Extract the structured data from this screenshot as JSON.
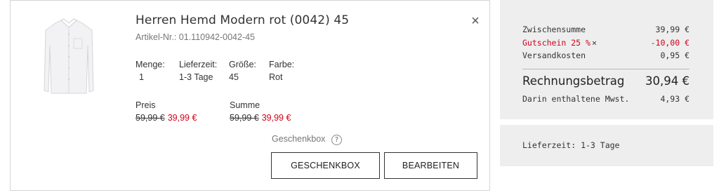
{
  "product": {
    "title": "Herren Hemd Modern rot (0042) 45",
    "article_number": "Artikel-Nr.: 01.110942-0042-45",
    "image_icon": "shirt-image",
    "close_icon": "×",
    "attributes": [
      {
        "label": "Menge:",
        "value": "1"
      },
      {
        "label": "Lieferzeit:",
        "value": "1-3 Tage"
      },
      {
        "label": "Größe:",
        "value": "45"
      },
      {
        "label": "Farbe:",
        "value": "Rot"
      }
    ],
    "price": {
      "label": "Preis",
      "old": "59,99 €",
      "new": "39,99 €"
    },
    "sum": {
      "label": "Summe",
      "old": "59,99 €",
      "new": "39,99 €"
    },
    "gift_label": "Geschenkbox",
    "help_icon": "?",
    "buttons": {
      "gift": "GESCHENKBOX",
      "edit": "BEARBEITEN"
    }
  },
  "summary": {
    "subtotal": {
      "label": "Zwischensumme",
      "value": "39,99 €"
    },
    "voucher": {
      "label": "Gutschein 25 %",
      "remove_icon": "×",
      "value": "-10,00 €"
    },
    "shipping": {
      "label": "Versandkosten",
      "value": "0,95 €"
    },
    "total": {
      "label": "Rechnungsbetrag",
      "value": "30,94 €"
    },
    "vat": {
      "label": "Darin enthaltene Mwst.",
      "value": "4,93 €"
    },
    "delivery": "Lieferzeit: 1-3 Tage"
  },
  "colors": {
    "sale_red": "#d0021b",
    "summary_bg": "#eeeeee",
    "border": "#d4d4d4"
  }
}
